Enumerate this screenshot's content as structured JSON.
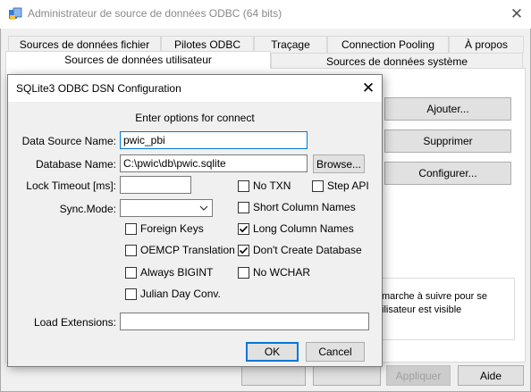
{
  "main": {
    "title": "Administrateur de source de données ODBC (64 bits)",
    "tabs_row1": [
      "Sources de données fichier",
      "Pilotes ODBC",
      "Traçage",
      "Connection Pooling",
      "À propos"
    ],
    "tabs_row2": [
      "Sources de données utilisateur",
      "Sources de données système"
    ],
    "buttons": {
      "add": "Ajouter...",
      "remove": "Supprimer",
      "configure": "Configurer...",
      "apply": "Appliquer",
      "help": "Aide"
    },
    "description": {
      "line1": "marche à suivre pour se",
      "line2": "ilisateur est visible"
    }
  },
  "dialog": {
    "title": "SQLite3 ODBC DSN Configuration",
    "header": "Enter options for connect",
    "labels": {
      "dsn": "Data Source Name:",
      "db": "Database Name:",
      "lock": "Lock Timeout [ms]:",
      "sync": "Sync.Mode:",
      "load_ext": "Load Extensions:"
    },
    "fields": {
      "dsn": "pwic_pbi",
      "db": "C:\\pwic\\db\\pwic.sqlite",
      "lock": "",
      "sync": "",
      "load_ext": ""
    },
    "browse": "Browse...",
    "checks_right": [
      {
        "label": "No TXN",
        "checked": false
      },
      {
        "label": "Step API",
        "checked": false
      },
      {
        "label": "Short Column Names",
        "checked": false
      },
      {
        "label": "Long Column Names",
        "checked": true
      },
      {
        "label": "Don't Create Database",
        "checked": true
      },
      {
        "label": "No WCHAR",
        "checked": false
      }
    ],
    "checks_left": [
      {
        "label": "Foreign Keys",
        "checked": false
      },
      {
        "label": "OEMCP Translation",
        "checked": false
      },
      {
        "label": "Always BIGINT",
        "checked": false
      },
      {
        "label": "Julian Day Conv.",
        "checked": false
      }
    ],
    "ok": "OK",
    "cancel": "Cancel"
  }
}
